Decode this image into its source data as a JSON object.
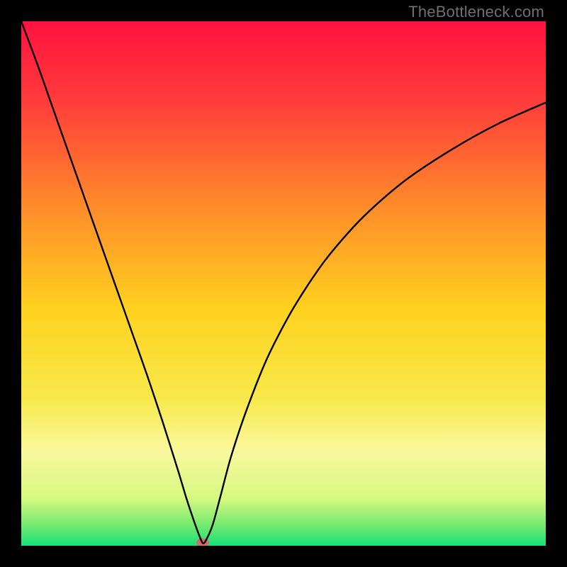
{
  "watermark": "TheBottleneck.com",
  "chart_data": {
    "type": "line",
    "title": "",
    "xlabel": "",
    "ylabel": "",
    "xlim": [
      0,
      100
    ],
    "ylim": [
      0,
      100
    ],
    "background_gradient": {
      "stops": [
        {
          "offset": 0.0,
          "color": "#ff123f"
        },
        {
          "offset": 0.15,
          "color": "#ff3b3b"
        },
        {
          "offset": 0.35,
          "color": "#ff8a2a"
        },
        {
          "offset": 0.55,
          "color": "#ffd21f"
        },
        {
          "offset": 0.72,
          "color": "#f7e94a"
        },
        {
          "offset": 0.82,
          "color": "#faf89e"
        },
        {
          "offset": 0.91,
          "color": "#d6f97f"
        },
        {
          "offset": 0.965,
          "color": "#6be86f"
        },
        {
          "offset": 1.0,
          "color": "#16e27a"
        }
      ]
    },
    "series": [
      {
        "name": "bottleneck-curve",
        "x": [
          0.0,
          3.0,
          6.0,
          9.0,
          12.0,
          15.0,
          18.0,
          21.0,
          24.0,
          27.0,
          30.0,
          31.5,
          33.0,
          34.0,
          34.6,
          35.2,
          36.5,
          38.0,
          40.0,
          43.0,
          47.0,
          52.0,
          58.0,
          65.0,
          73.0,
          82.0,
          91.0,
          100.0
        ],
        "y": [
          100.0,
          92.0,
          83.5,
          75.0,
          66.5,
          58.0,
          49.5,
          41.0,
          32.5,
          23.5,
          14.0,
          9.0,
          4.5,
          1.8,
          0.5,
          1.0,
          4.0,
          9.5,
          17.0,
          26.0,
          36.0,
          45.5,
          54.5,
          62.5,
          69.5,
          75.5,
          80.5,
          84.5
        ]
      }
    ],
    "marker": {
      "x": 34.6,
      "y": 0.6,
      "color": "#d46a6a",
      "rx": 9,
      "ry": 6
    }
  }
}
